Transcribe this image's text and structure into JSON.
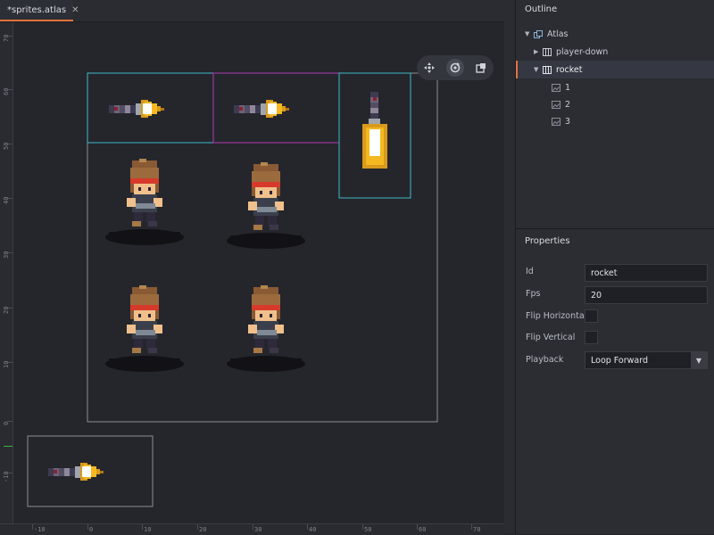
{
  "tab": {
    "title": "*sprites.atlas",
    "close": "✕"
  },
  "rulers": {
    "vertical": [
      "70",
      "60",
      "50",
      "40",
      "30",
      "20",
      "10",
      "0",
      "-10"
    ],
    "horizontal": [
      "-10",
      "0",
      "10",
      "20",
      "30",
      "40",
      "50",
      "60",
      "70"
    ]
  },
  "toolbar": {
    "icons": [
      "move-tool-icon",
      "rotate-tool-icon",
      "scale-tool-icon"
    ],
    "active": "rotate-tool-icon"
  },
  "outline": {
    "title": "Outline",
    "items": [
      {
        "label": "Atlas",
        "expanded": true,
        "icon": "atlas-icon"
      },
      {
        "label": "player-down",
        "expanded": false,
        "icon": "animation-icon"
      },
      {
        "label": "rocket",
        "expanded": true,
        "icon": "animation-icon",
        "selected": true
      },
      {
        "label": "1",
        "icon": "image-icon"
      },
      {
        "label": "2",
        "icon": "image-icon"
      },
      {
        "label": "3",
        "icon": "image-icon"
      }
    ]
  },
  "properties": {
    "title": "Properties",
    "id_label": "Id",
    "id_value": "rocket",
    "fps_label": "Fps",
    "fps_value": "20",
    "flip_h_label": "Flip Horizontal",
    "flip_h": false,
    "flip_v_label": "Flip Vertical",
    "flip_v": false,
    "playback_label": "Playback",
    "playback_value": "Loop Forward",
    "dropdown_arrow": "▼"
  },
  "colors": {
    "accent": "#e2733f",
    "selection_cyan": "#3fbac4",
    "selection_magenta": "#b03ab4",
    "atlas_border": "#8a8d94"
  }
}
